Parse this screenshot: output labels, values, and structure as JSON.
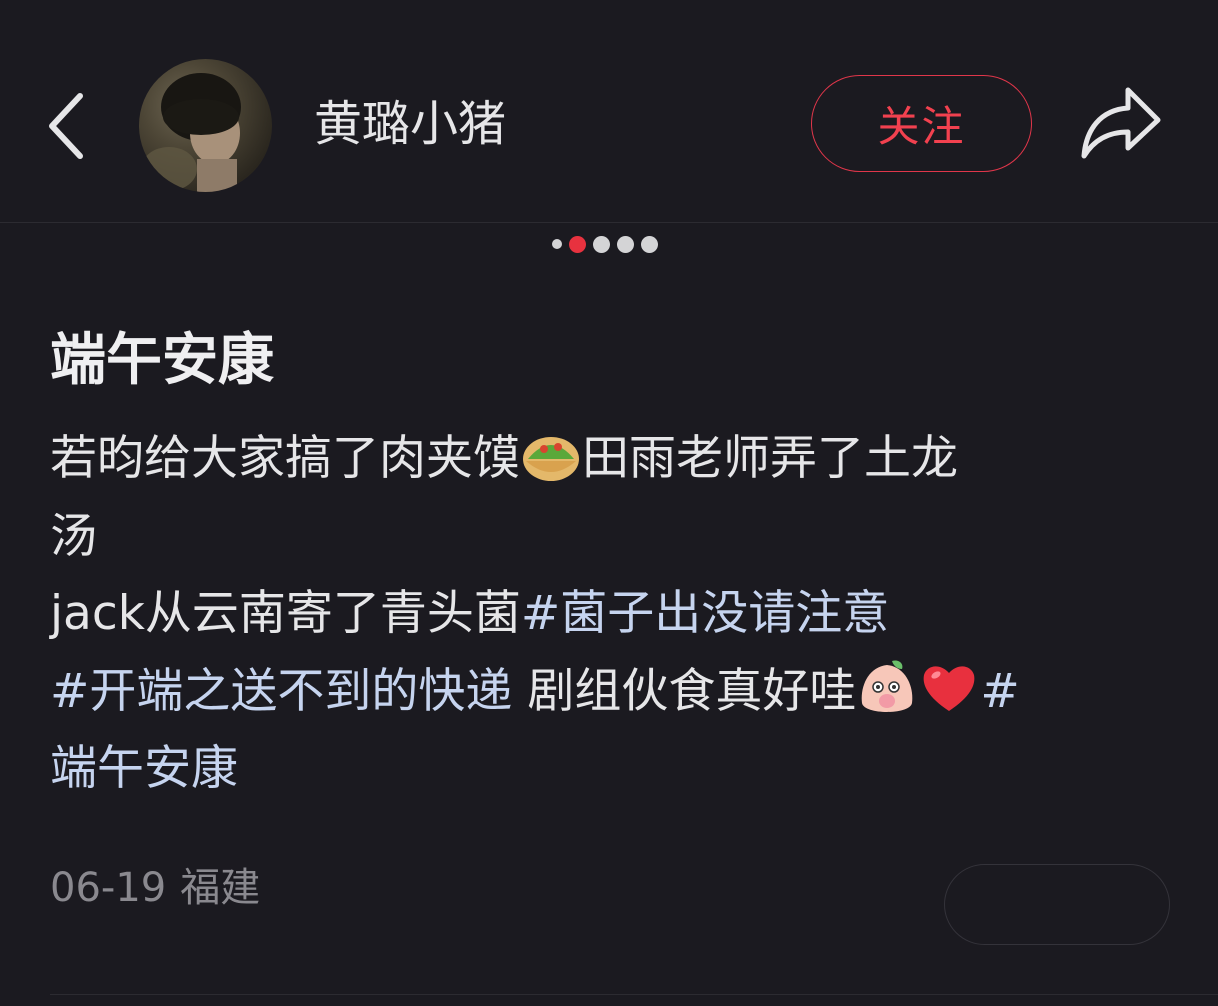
{
  "header": {
    "username": "黄璐小猪",
    "follow_label": "关注",
    "back_icon": "chevron-left-icon",
    "share_icon": "share-arrow-icon",
    "avatar_icon": "avatar"
  },
  "carousel": {
    "total_dots": 5,
    "active_index": 1
  },
  "post": {
    "title": "端午安康",
    "line1_text_a": "若昀给大家搞了肉夹馍",
    "line1_emoji": "taco-emoji",
    "line1_text_b": "田雨老师弄了土龙",
    "line2_text": "汤",
    "line3_text": "jack从云南寄了青头菌",
    "line3_hashtag": "#菌子出没请注意",
    "line4_hashtag": "#开端之送不到的快递",
    "line4_text": " 剧组伙食真好哇",
    "line4_emoji_1": "blushing-peach-emoji",
    "line4_emoji_2": "red-heart-emoji",
    "line4_hashtag_start": "#",
    "line5_hashtag": "端午安康"
  },
  "meta": {
    "date": "06-19",
    "location": "福建"
  },
  "colors": {
    "background": "#1b1a20",
    "accent": "#e8323f",
    "hashtag": "#c6d4ef",
    "meta_text": "#8a898f"
  }
}
